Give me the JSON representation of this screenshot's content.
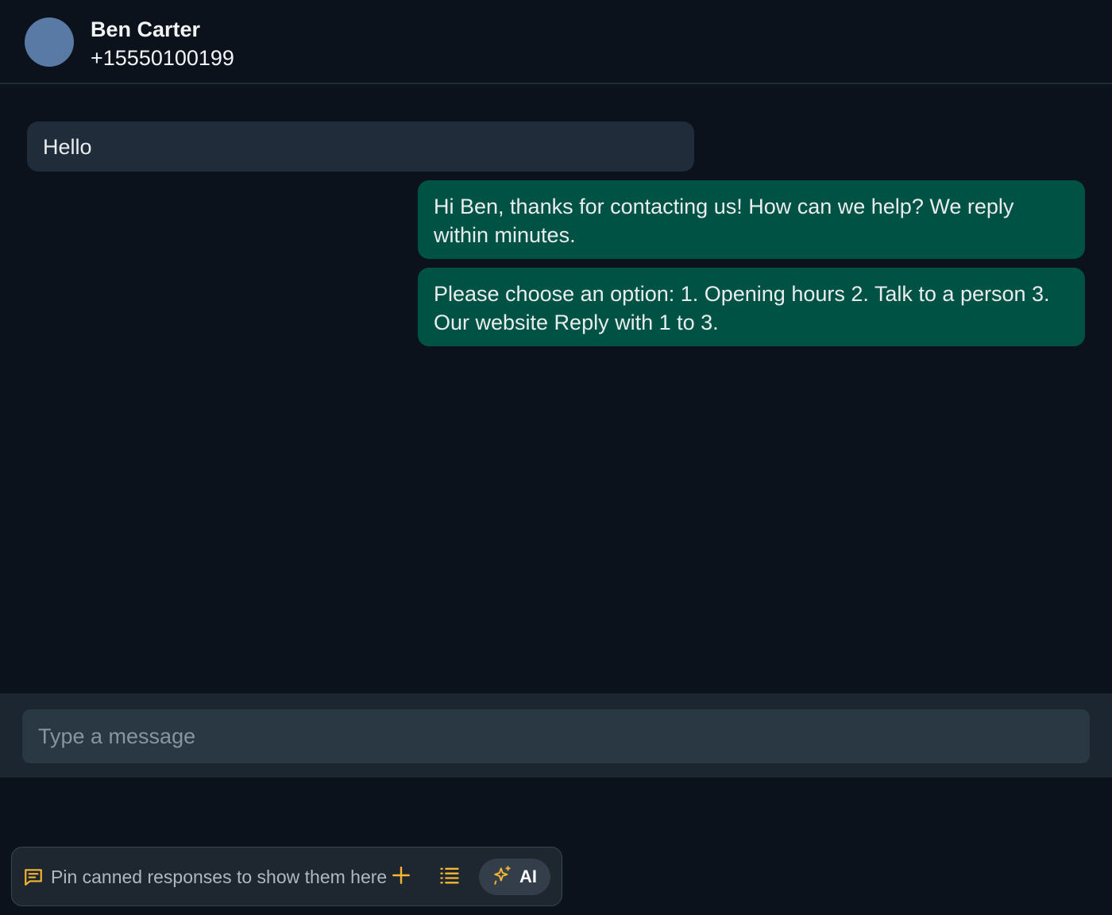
{
  "contact": {
    "name": "Ben Carter",
    "phone": "+15550100199"
  },
  "messages": [
    {
      "direction": "incoming",
      "text": "Hello"
    },
    {
      "direction": "outgoing",
      "text": "Hi Ben, thanks for contacting us! How can we help? We reply within minutes."
    },
    {
      "direction": "outgoing",
      "text": "Please choose an option: 1. Opening hours 2. Talk to a person 3. Our website Reply with 1 to 3."
    }
  ],
  "composer": {
    "placeholder": "Type a message",
    "value": ""
  },
  "canned": {
    "hint": "Pin canned responses to show them here",
    "ai_label": "AI"
  },
  "icons": {
    "canned": "message-square-text-icon",
    "add": "plus-icon",
    "list": "list-icon",
    "ai": "sparkles-icon"
  },
  "colors": {
    "background": "#0b121c",
    "incoming_bubble": "#202c39",
    "outgoing_bubble": "#005344",
    "accent": "#f4b731"
  }
}
